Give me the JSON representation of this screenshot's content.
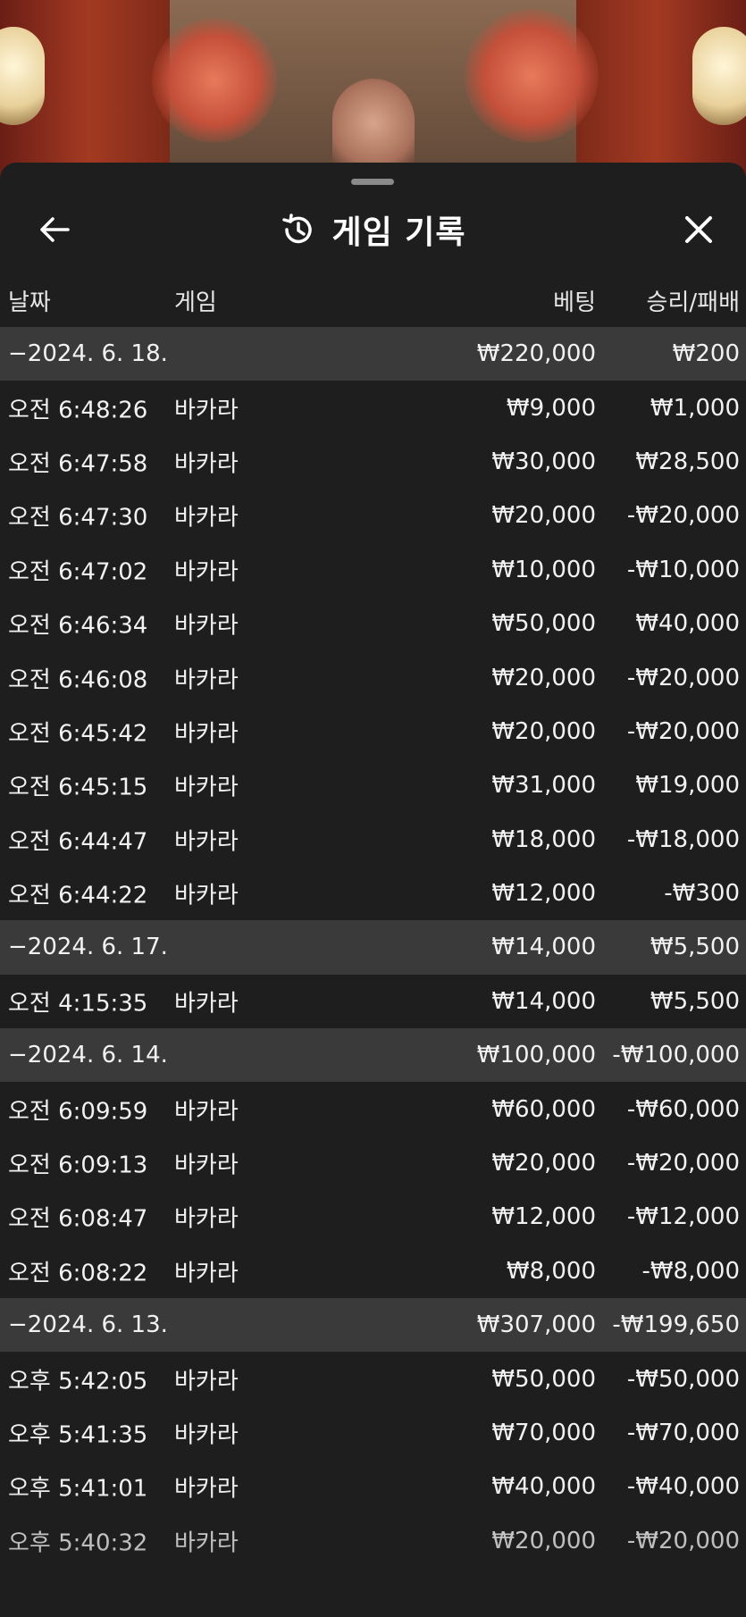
{
  "header": {
    "title": "게임 기록",
    "back_icon": "arrow-left-icon",
    "history_icon": "history-icon",
    "close_icon": "close-icon"
  },
  "columns": {
    "date": "날짜",
    "game": "게임",
    "bet": "베팅",
    "result": "승리/패배"
  },
  "rows": [
    {
      "type": "group",
      "date": "−2024. 6. 18.",
      "game": "",
      "bet": "₩220,000",
      "result": "₩200"
    },
    {
      "type": "entry",
      "date": "오전 6:48:26",
      "game": "바카라",
      "bet": "₩9,000",
      "result": "₩1,000"
    },
    {
      "type": "entry",
      "date": "오전 6:47:58",
      "game": "바카라",
      "bet": "₩30,000",
      "result": "₩28,500"
    },
    {
      "type": "entry",
      "date": "오전 6:47:30",
      "game": "바카라",
      "bet": "₩20,000",
      "result": "-₩20,000"
    },
    {
      "type": "entry",
      "date": "오전 6:47:02",
      "game": "바카라",
      "bet": "₩10,000",
      "result": "-₩10,000"
    },
    {
      "type": "entry",
      "date": "오전 6:46:34",
      "game": "바카라",
      "bet": "₩50,000",
      "result": "₩40,000"
    },
    {
      "type": "entry",
      "date": "오전 6:46:08",
      "game": "바카라",
      "bet": "₩20,000",
      "result": "-₩20,000"
    },
    {
      "type": "entry",
      "date": "오전 6:45:42",
      "game": "바카라",
      "bet": "₩20,000",
      "result": "-₩20,000"
    },
    {
      "type": "entry",
      "date": "오전 6:45:15",
      "game": "바카라",
      "bet": "₩31,000",
      "result": "₩19,000"
    },
    {
      "type": "entry",
      "date": "오전 6:44:47",
      "game": "바카라",
      "bet": "₩18,000",
      "result": "-₩18,000"
    },
    {
      "type": "entry",
      "date": "오전 6:44:22",
      "game": "바카라",
      "bet": "₩12,000",
      "result": "-₩300"
    },
    {
      "type": "group",
      "date": "−2024. 6. 17.",
      "game": "",
      "bet": "₩14,000",
      "result": "₩5,500"
    },
    {
      "type": "entry",
      "date": "오전 4:15:35",
      "game": "바카라",
      "bet": "₩14,000",
      "result": "₩5,500"
    },
    {
      "type": "group",
      "date": "−2024. 6. 14.",
      "game": "",
      "bet": "₩100,000",
      "result": "-₩100,000"
    },
    {
      "type": "entry",
      "date": "오전 6:09:59",
      "game": "바카라",
      "bet": "₩60,000",
      "result": "-₩60,000"
    },
    {
      "type": "entry",
      "date": "오전 6:09:13",
      "game": "바카라",
      "bet": "₩20,000",
      "result": "-₩20,000"
    },
    {
      "type": "entry",
      "date": "오전 6:08:47",
      "game": "바카라",
      "bet": "₩12,000",
      "result": "-₩12,000"
    },
    {
      "type": "entry",
      "date": "오전 6:08:22",
      "game": "바카라",
      "bet": "₩8,000",
      "result": "-₩8,000"
    },
    {
      "type": "group",
      "date": "−2024. 6. 13.",
      "game": "",
      "bet": "₩307,000",
      "result": "-₩199,650"
    },
    {
      "type": "entry",
      "date": "오후 5:42:05",
      "game": "바카라",
      "bet": "₩50,000",
      "result": "-₩50,000"
    },
    {
      "type": "entry",
      "date": "오후 5:41:35",
      "game": "바카라",
      "bet": "₩70,000",
      "result": "-₩70,000"
    },
    {
      "type": "entry",
      "date": "오후 5:41:01",
      "game": "바카라",
      "bet": "₩40,000",
      "result": "-₩40,000"
    },
    {
      "type": "entry",
      "date": "오후 5:40:32",
      "game": "바카라",
      "bet": "₩20,000",
      "result": "-₩20,000"
    }
  ],
  "colors": {
    "sheet_bg": "#1e1e1e",
    "group_row_bg": "#3a3a3a",
    "text": "#f2f2f2"
  }
}
